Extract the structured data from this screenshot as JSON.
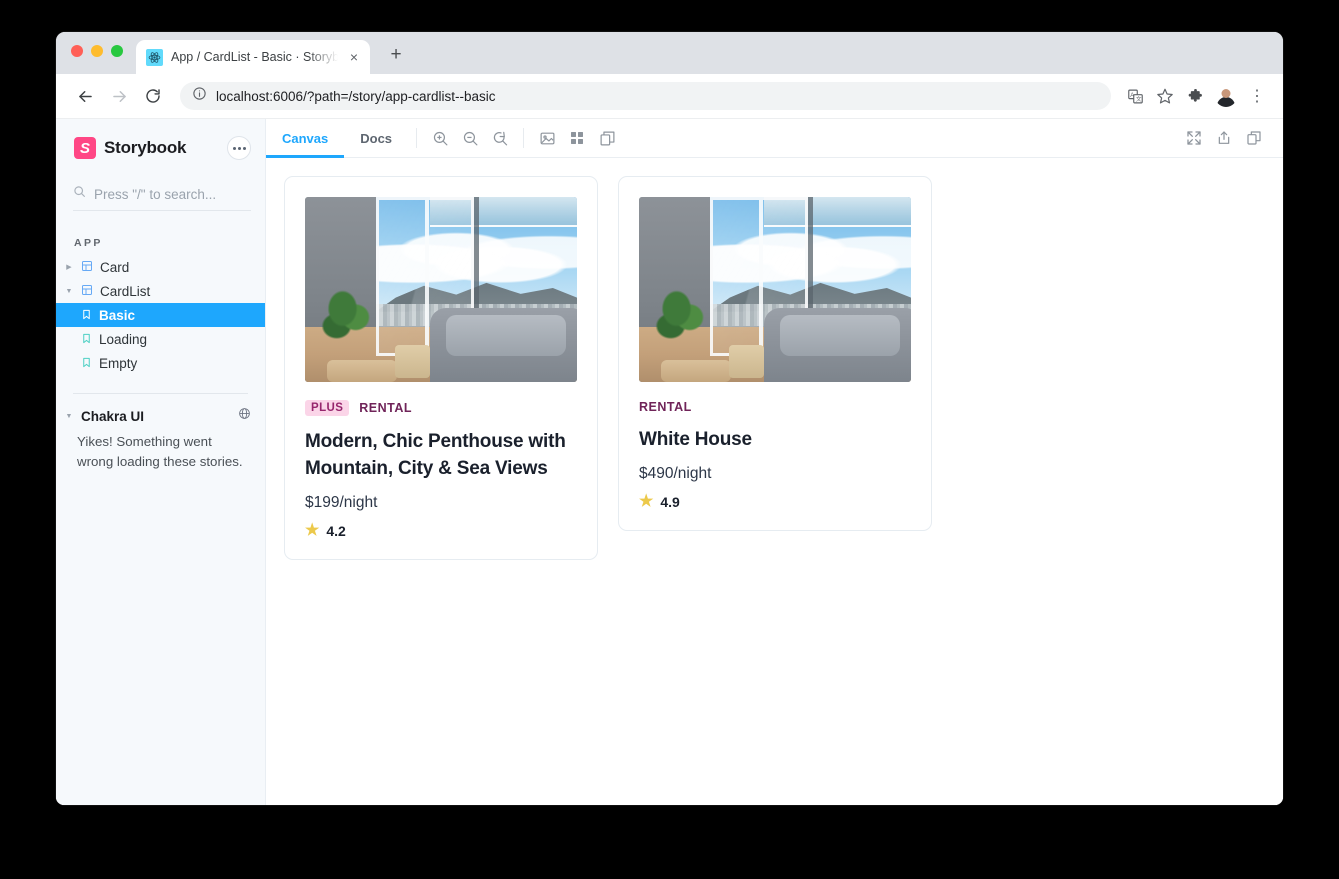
{
  "browser": {
    "tab": {
      "title": "App / CardList - Basic · Storybook",
      "favicon": "react-icon",
      "close": "×"
    },
    "new_tab_label": "+",
    "nav": {
      "back": "←",
      "forward": "→",
      "reload": "⟳"
    },
    "omnibox": {
      "info_icon": "info-icon",
      "url": "localhost:6006/?path=/story/app-cardlist--basic"
    },
    "actions": {
      "translate": "translate-icon",
      "bookmark": "star-icon",
      "extensions": "puzzle-icon",
      "profile": "avatar",
      "menu": "⋮"
    }
  },
  "sidebar": {
    "brand": {
      "logo_letter": "S",
      "name": "Storybook",
      "accent": "#ff4785"
    },
    "menu_button": "dots-menu-icon",
    "search": {
      "placeholder": "Press \"/\" to search...",
      "value": ""
    },
    "group_label": "APP",
    "tree": [
      {
        "label": "Card",
        "type": "component",
        "expanded": false,
        "caret": "▶",
        "selected": false
      },
      {
        "label": "CardList",
        "type": "component",
        "expanded": true,
        "caret": "▼",
        "selected": false
      },
      {
        "label": "Basic",
        "type": "story",
        "selected": true
      },
      {
        "label": "Loading",
        "type": "story",
        "selected": false
      },
      {
        "label": "Empty",
        "type": "story",
        "selected": false
      }
    ],
    "section": {
      "caret": "▼",
      "title": "Chakra UI",
      "icon": "globe-icon",
      "error": "Yikes! Something went wrong loading these stories."
    }
  },
  "toolbar": {
    "tabs": [
      {
        "label": "Canvas",
        "active": true
      },
      {
        "label": "Docs",
        "active": false
      }
    ],
    "zoom_in": "zoom-in-icon",
    "zoom_out": "zoom-out-icon",
    "zoom_reset": "zoom-reset-icon",
    "background": "image-icon",
    "grid": "grid-icon",
    "measure": "measure-icon",
    "fullscreen": "fullscreen-icon",
    "open_new_tab": "share-icon",
    "copy_link": "copy-icon",
    "accent": "#1ea7fd"
  },
  "canvas": {
    "cards": [
      {
        "image": "penthouse-living-room-photo",
        "plus_badge": "PLUS",
        "category": "RENTAL",
        "title": "Modern, Chic Penthouse with Mountain, City & Sea Views",
        "price": "$199/night",
        "rating": "4.2",
        "star": "★"
      },
      {
        "image": "penthouse-living-room-photo",
        "plus_badge": "",
        "category": "RENTAL",
        "title": "White House",
        "price": "$490/night",
        "rating": "4.9",
        "star": "★"
      }
    ]
  }
}
